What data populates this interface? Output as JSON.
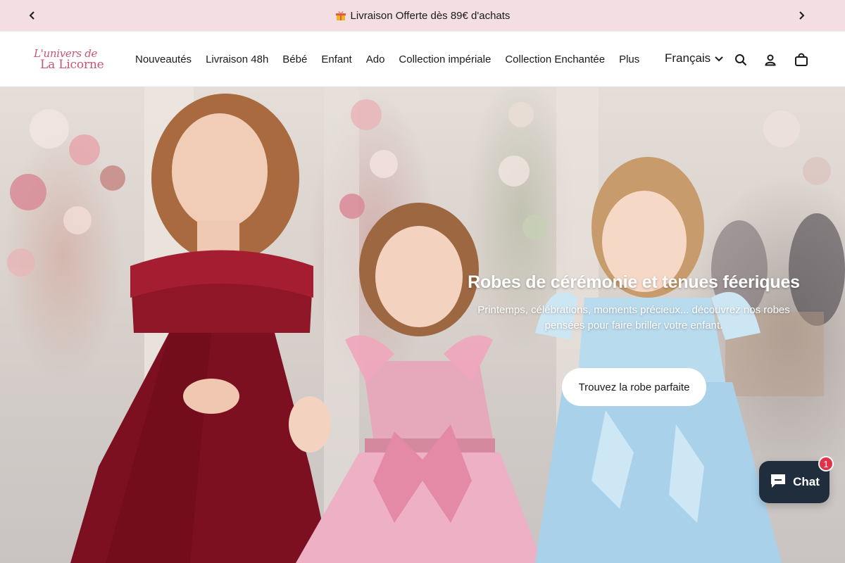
{
  "announcement": {
    "message": "Livraison Offerte dès 89€ d'achats",
    "prev_icon": "chevron-left-icon",
    "next_icon": "chevron-right-icon",
    "gift_icon": "gift-icon"
  },
  "header": {
    "logo": {
      "line1": "L'univers de",
      "line2": "La Licorne"
    },
    "nav": [
      {
        "label": "Nouveautés"
      },
      {
        "label": "Livraison 48h"
      },
      {
        "label": "Bébé"
      },
      {
        "label": "Enfant"
      },
      {
        "label": "Ado"
      },
      {
        "label": "Collection impériale"
      },
      {
        "label": "Collection Enchantée"
      },
      {
        "label": "Plus"
      }
    ],
    "language": "Français",
    "icons": [
      "search-icon",
      "account-icon",
      "cart-icon"
    ]
  },
  "hero": {
    "title": "Robes de cérémonie et tenues féeriques",
    "subtitle_line1": "Printemps, célébrations, moments précieux... découvrez nos robes",
    "subtitle_line2": "pensées pour faire briller votre enfant.",
    "cta": "Trouvez la robe parfaite"
  },
  "chat": {
    "label": "Chat",
    "badge_count": "1",
    "color": "#1f2d3d"
  },
  "colors": {
    "announcement_bg": "#f3dfe3",
    "brand": "#c9566f",
    "badge": "#e0334a"
  }
}
